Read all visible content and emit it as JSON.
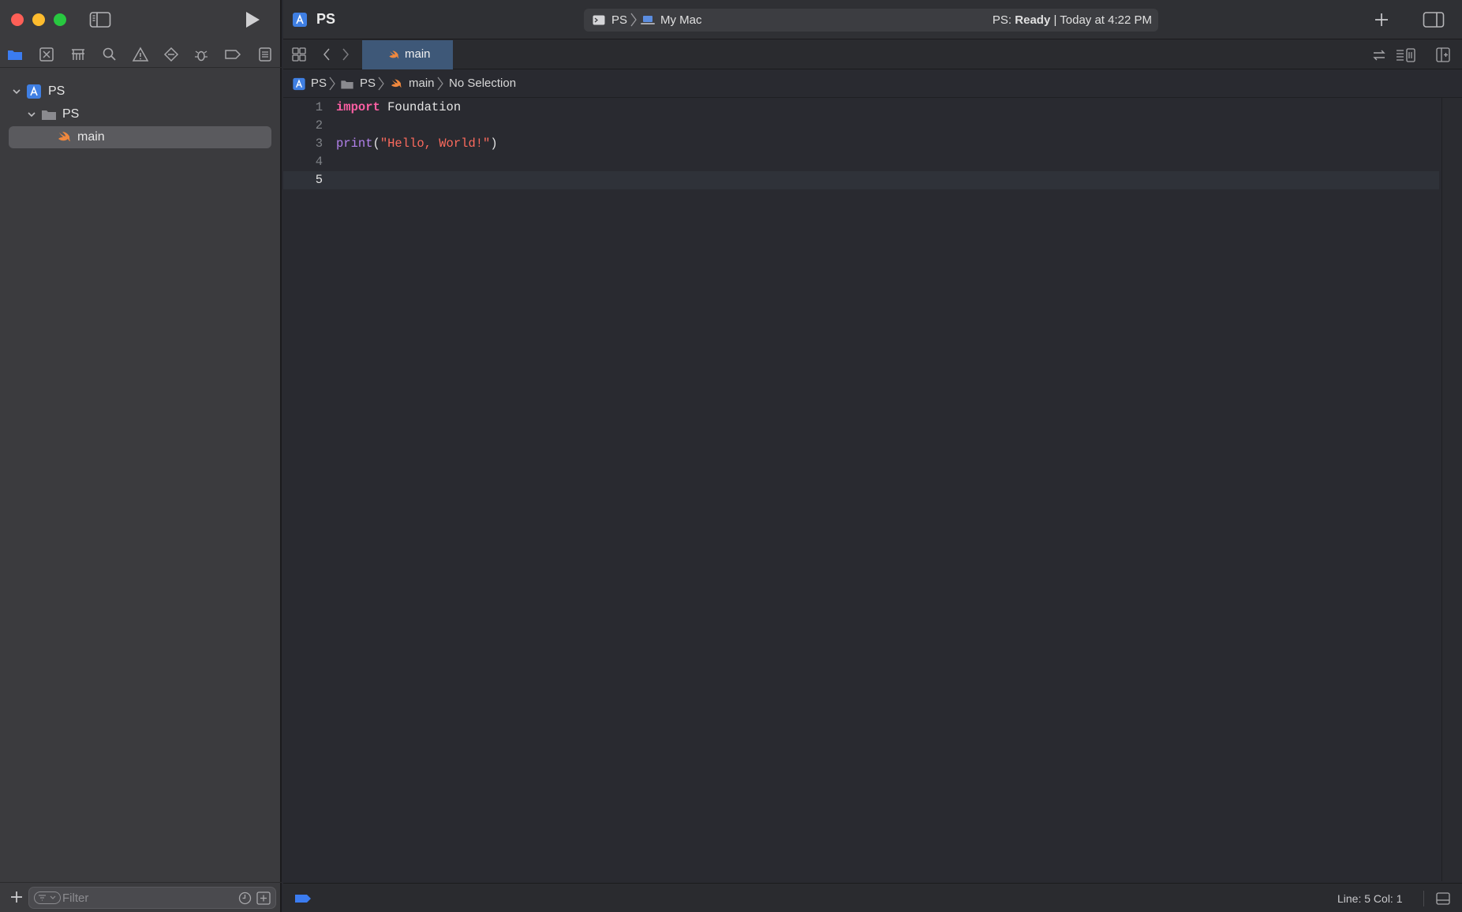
{
  "window": {
    "project_title": "PS"
  },
  "activity": {
    "scheme": "PS",
    "destination": "My Mac",
    "status_prefix": "PS: ",
    "status_state": "Ready",
    "status_suffix": " | Today at 4:22 PM"
  },
  "navigator": {
    "tree": [
      {
        "label": "PS",
        "kind": "project",
        "expanded": true
      },
      {
        "label": "PS",
        "kind": "folder",
        "expanded": true
      },
      {
        "label": "main",
        "kind": "swift-file",
        "selected": true
      }
    ],
    "filter_placeholder": "Filter"
  },
  "editor": {
    "tab_label": "main",
    "jumpbar": [
      "PS",
      "PS",
      "main",
      "No Selection"
    ],
    "lines": [
      {
        "num": "1",
        "tokens": [
          {
            "t": "import",
            "c": "kw"
          },
          {
            "t": " Foundation",
            "c": ""
          }
        ]
      },
      {
        "num": "2",
        "tokens": []
      },
      {
        "num": "3",
        "tokens": [
          {
            "t": "print",
            "c": "fn"
          },
          {
            "t": "(",
            "c": ""
          },
          {
            "t": "\"Hello, World!\"",
            "c": "str"
          },
          {
            "t": ")",
            "c": ""
          }
        ]
      },
      {
        "num": "4",
        "tokens": []
      },
      {
        "num": "5",
        "tokens": [],
        "current": true
      }
    ]
  },
  "statusbar": {
    "position": "Line: 5  Col: 1"
  },
  "colors": {
    "keyword": "#fc5fa3",
    "function": "#b281eb",
    "string": "#fc6a5d",
    "accent": "#3b7cf0",
    "swift": "#f0883e"
  },
  "icons": {
    "toolbar": [
      "sidebar-toggle-icon",
      "run-icon",
      "plus-icon",
      "inspector-toggle-icon"
    ],
    "navigator_bar": [
      "folder-icon",
      "source-control-icon",
      "symbol-icon",
      "search-icon",
      "warning-icon",
      "test-icon",
      "debug-icon",
      "breakpoint-icon",
      "report-icon"
    ]
  }
}
